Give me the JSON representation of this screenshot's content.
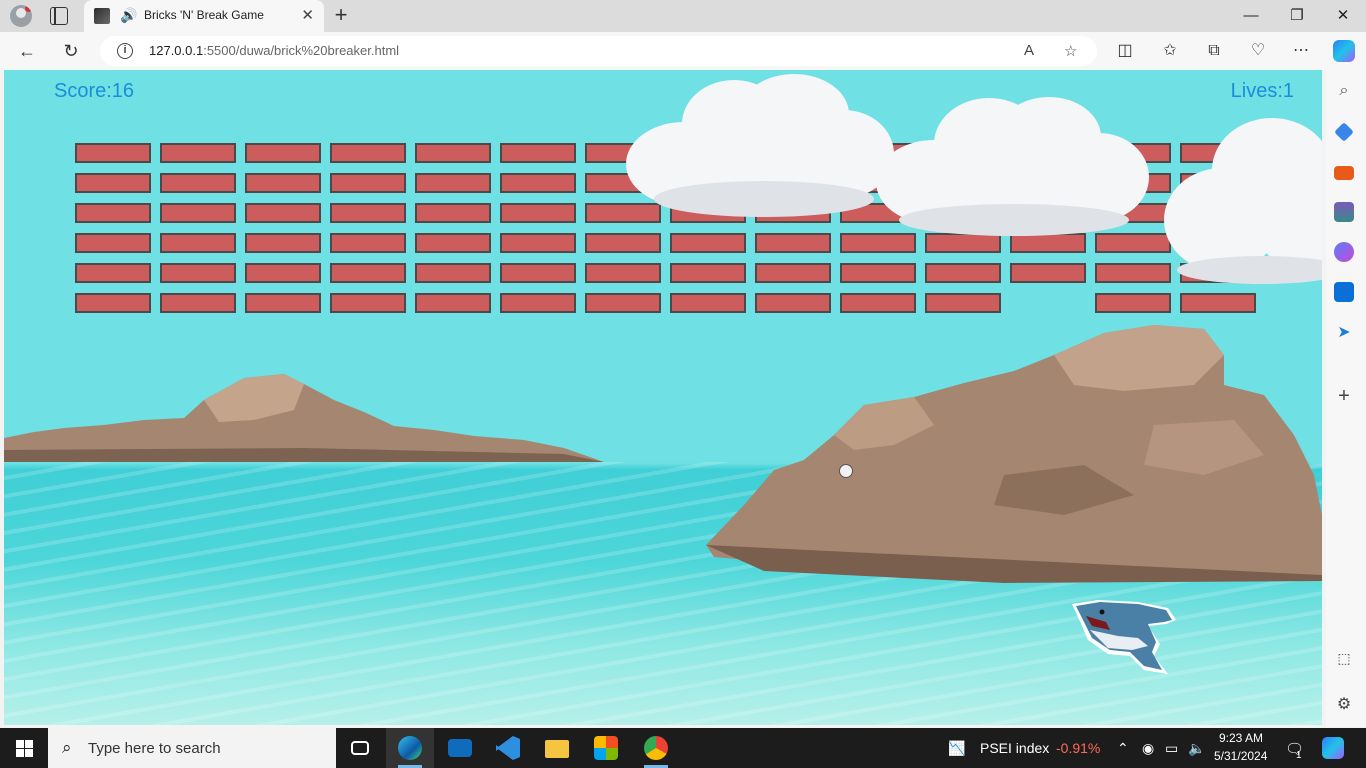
{
  "browser": {
    "tab_title": "Bricks 'N' Break Game",
    "url_host": "127.0.0.1",
    "url_path": ":5500/duwa/brick%20breaker.html"
  },
  "game": {
    "score_text": "Score:16",
    "lives_text": "Lives:1"
  },
  "taskbar": {
    "search_placeholder": "Type here to search",
    "stock_name": "PSEI index",
    "stock_change": "-0.91%",
    "time": "9:23 AM",
    "date": "5/31/2024",
    "notification_count": "1"
  },
  "colors": {
    "brick": "#cd5c5c",
    "score_text": "#1a8fd8",
    "stock_negative": "#ff6b5b"
  },
  "icons": [
    "profile-icon",
    "tab-actions-icon",
    "speaker-icon",
    "close-icon",
    "new-tab-icon",
    "back-icon",
    "refresh-icon",
    "info-icon",
    "read-aloud-icon",
    "favorite-star-icon",
    "split-screen-icon",
    "favorites-icon",
    "collections-icon",
    "browser-essentials-icon",
    "more-icon",
    "copilot-icon",
    "search-icon",
    "shopping-icon",
    "tools-icon",
    "games-icon",
    "m365-icon",
    "outlook-icon",
    "send-icon",
    "add-icon",
    "screenshot-icon",
    "settings-icon",
    "windows-start-icon",
    "task-view-icon"
  ]
}
